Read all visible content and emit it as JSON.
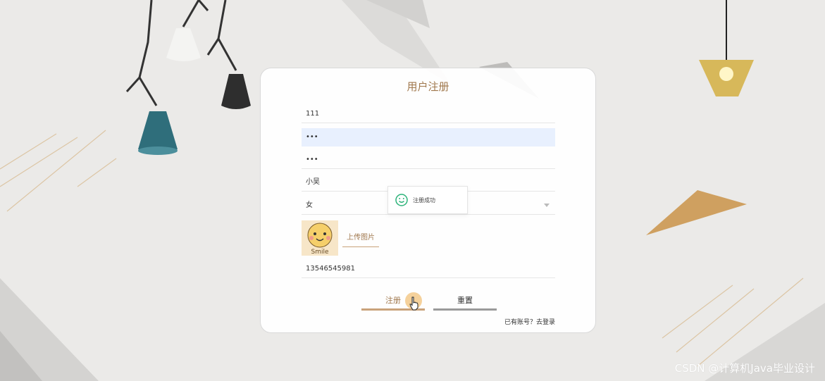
{
  "form": {
    "title": "用户注册",
    "username": "111",
    "password": "•••",
    "confirm_password": "•••",
    "name": "小吴",
    "gender": "女",
    "upload_label": "上传图片",
    "avatar_text": "Smile",
    "phone": "13546545981",
    "register_label": "注册",
    "reset_label": "重置",
    "login_link": "已有账号？去登录"
  },
  "toast": {
    "message": "注册成功",
    "icon": "smile-check-icon"
  },
  "watermark": "CSDN @计算机Java毕业设计",
  "colors": {
    "accent": "#a0784d",
    "background": "#ebeae8",
    "success": "#2db37a"
  }
}
